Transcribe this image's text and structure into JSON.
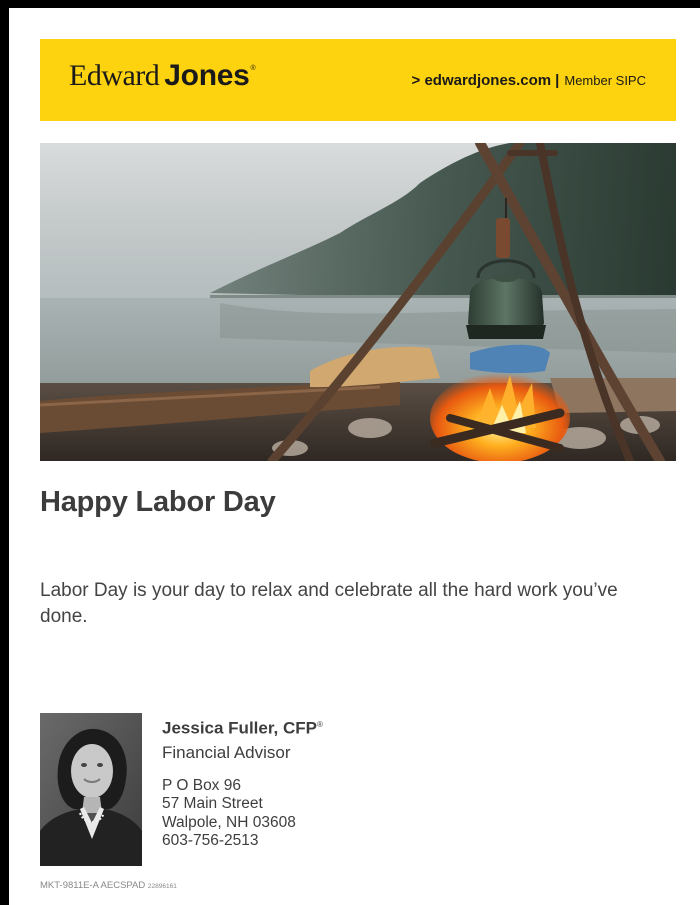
{
  "header": {
    "logo_edward": "Edward",
    "logo_jones": "Jones",
    "logo_reg": "®",
    "website_link": "> edwardjones.com",
    "separator": "|",
    "member_sipc": "Member SIPC",
    "background_color": "#fdd20e"
  },
  "hero_image": {
    "icon": "campfire-lake-photo"
  },
  "headline": "Happy Labor Day",
  "body": "Labor Day is your day to relax and celebrate all the hard work you’ve done.",
  "advisor": {
    "name": "Jessica Fuller, CFP",
    "name_reg": "®",
    "title": "Financial Advisor",
    "address": [
      "P O Box 96",
      "57 Main Street",
      "Walpole, NH 03608",
      "603-756-2513"
    ]
  },
  "footer": {
    "code": "MKT-9811E-A  AECSPAD",
    "code_number": "22896161"
  }
}
